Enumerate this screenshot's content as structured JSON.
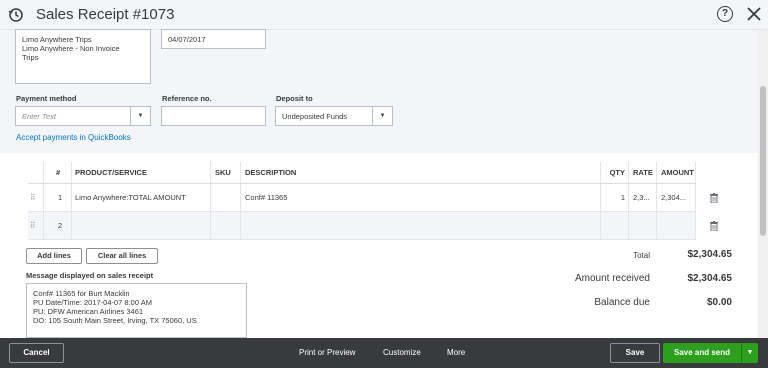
{
  "header": {
    "title": "Sales Receipt #1073",
    "help": "?"
  },
  "billing": {
    "address_lines": [
      "Limo Anywhere Trips",
      "Limo Anywhere - Non Invoice",
      "Trips"
    ],
    "date": "04/07/2017"
  },
  "payment": {
    "method_label": "Payment method",
    "method_placeholder": "Enter Text",
    "reference_label": "Reference no.",
    "reference_value": "",
    "deposit_label": "Deposit to",
    "deposit_value": "Undeposited Funds",
    "accept_link": "Accept payments in QuickBooks"
  },
  "table": {
    "headers": {
      "num": "#",
      "product": "PRODUCT/SERVICE",
      "sku": "SKU",
      "description": "DESCRIPTION",
      "qty": "QTY",
      "rate": "RATE",
      "amount": "AMOUNT"
    },
    "rows": [
      {
        "num": "1",
        "product": "Limo Anywhere:TOTAL AMOUNT",
        "sku": "",
        "description": "Conf# 11365",
        "qty": "1",
        "rate": "2,3...",
        "amount": "2,304..."
      },
      {
        "num": "2",
        "product": "",
        "sku": "",
        "description": "",
        "qty": "",
        "rate": "",
        "amount": ""
      }
    ]
  },
  "actions": {
    "add_lines": "Add lines",
    "clear_all": "Clear all lines"
  },
  "message": {
    "label": "Message displayed on sales receipt",
    "lines": [
      "Conf# 11365 for Burt Macklin",
      "PU Date/Time: 2017-04-07 8:00 AM",
      "PU: DFW American Airlines 3461",
      "DO: 105 South Main Street, Irving, TX 75060, US"
    ]
  },
  "totals": {
    "total_label": "Total",
    "total_value": "$2,304.65",
    "received_label": "Amount received",
    "received_value": "$2,304.65",
    "balance_label": "Balance due",
    "balance_value": "$0.00"
  },
  "footer": {
    "cancel": "Cancel",
    "print": "Print or Preview",
    "customize": "Customize",
    "more": "More",
    "save": "Save",
    "save_and_send": "Save and send"
  },
  "colors": {
    "accent_green": "#2ca01c",
    "link_blue": "#0077c5",
    "footer_bg": "#393a3d"
  }
}
